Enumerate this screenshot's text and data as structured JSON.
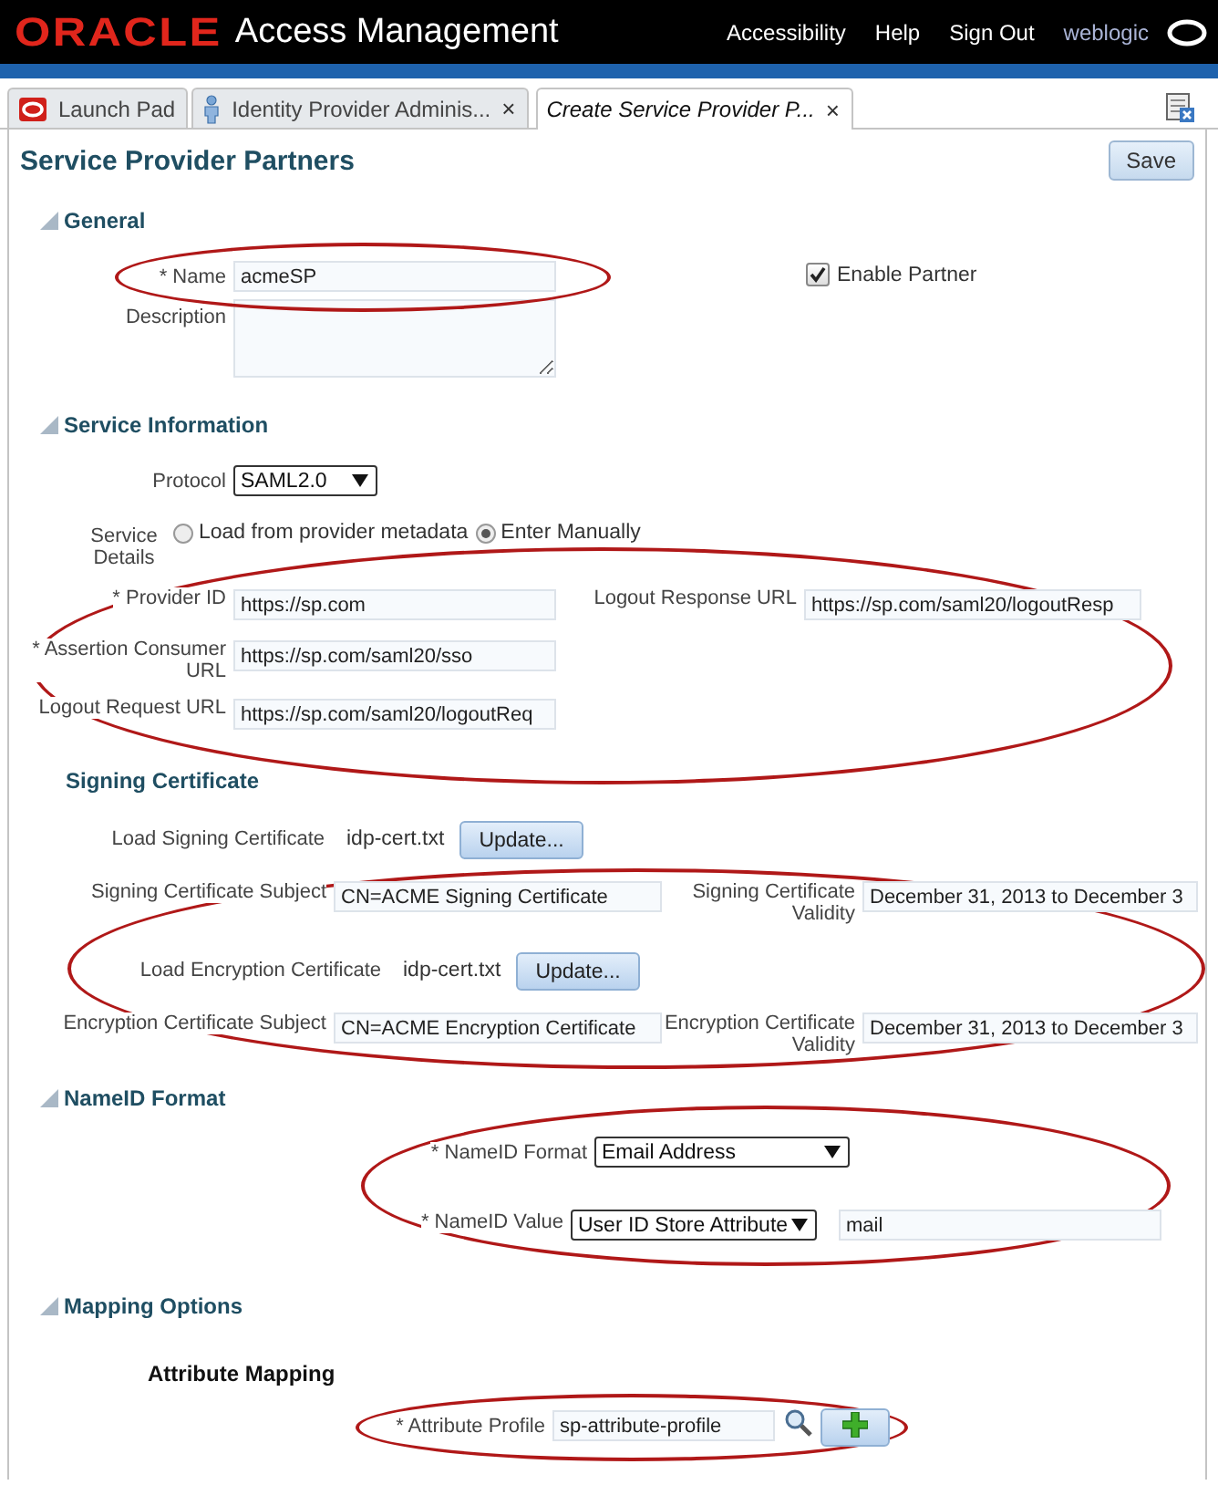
{
  "header": {
    "logo": "ORACLE",
    "title": "Access Management",
    "links": [
      "Accessibility",
      "Help",
      "Sign Out"
    ],
    "user": "weblogic"
  },
  "tabs": [
    {
      "label": "Launch Pad",
      "selected": false
    },
    {
      "label": "Identity Provider Adminis...",
      "close": "×",
      "selected": false
    },
    {
      "label": "Create Service Provider P...",
      "close": "×",
      "selected": true
    }
  ],
  "page": {
    "title": "Service Provider Partners",
    "save": "Save"
  },
  "general": {
    "heading": "General",
    "expanded": true,
    "name": {
      "label": "* Name",
      "value": "acmeSP",
      "circled": true
    },
    "description": {
      "label": "Description"
    },
    "enable_partner": {
      "label": "Enable Partner",
      "checked": true
    }
  },
  "service_information": {
    "heading": "Service Information",
    "expanded": true,
    "protocol": {
      "label": "Protocol",
      "value": "SAML2.0"
    },
    "service_details": {
      "label": "Service Details",
      "options": [
        {
          "label": "Load from provider metadata",
          "selected": false
        },
        {
          "label": "Enter Manually",
          "selected": true
        }
      ]
    },
    "circled": true,
    "left_fields": [
      {
        "label": "* Provider ID",
        "value": "https://sp.com"
      },
      {
        "label": "* Assertion Consumer URL",
        "value": "https://sp.com/saml20/sso"
      },
      {
        "label": "Logout Request URL",
        "value": "https://sp.com/saml20/logoutReq"
      }
    ],
    "right_fields": [
      {
        "label": "Logout Response URL",
        "value": "https://sp.com/saml20/logoutResp"
      }
    ]
  },
  "signing_certificate": {
    "heading": "Signing Certificate",
    "circled": true,
    "rows": [
      {
        "kind": "upload",
        "label": "Load Signing Certificate",
        "file": "idp-cert.txt",
        "button": "Update..."
      },
      {
        "kind": "pair",
        "label": "Signing Certificate Subject",
        "value": "CN=ACME Signing Certificate",
        "right_label": "Signing Certificate Validity",
        "right_value": "December 31, 2013 to December 3"
      },
      {
        "kind": "upload",
        "label": "Load Encryption Certificate",
        "file": "idp-cert.txt",
        "button": "Update..."
      },
      {
        "kind": "pair",
        "label": "Encryption Certificate Subject",
        "value": "CN=ACME Encryption Certificate",
        "right_label": "Encryption Certificate Validity",
        "right_value": "December 31, 2013 to December 3"
      }
    ]
  },
  "nameid_format": {
    "heading": "NameID Format",
    "expanded": true,
    "circled": true,
    "format": {
      "label": "* NameID Format",
      "value": "Email Address"
    },
    "value": {
      "label": "* NameID Value",
      "select": "User ID Store Attribute",
      "value": "mail"
    }
  },
  "mapping_options": {
    "heading": "Mapping Options",
    "expanded": true,
    "subheading": "Attribute Mapping",
    "attribute_profile": {
      "label": "* Attribute Profile",
      "value": "sp-attribute-profile",
      "circled": true
    }
  }
}
